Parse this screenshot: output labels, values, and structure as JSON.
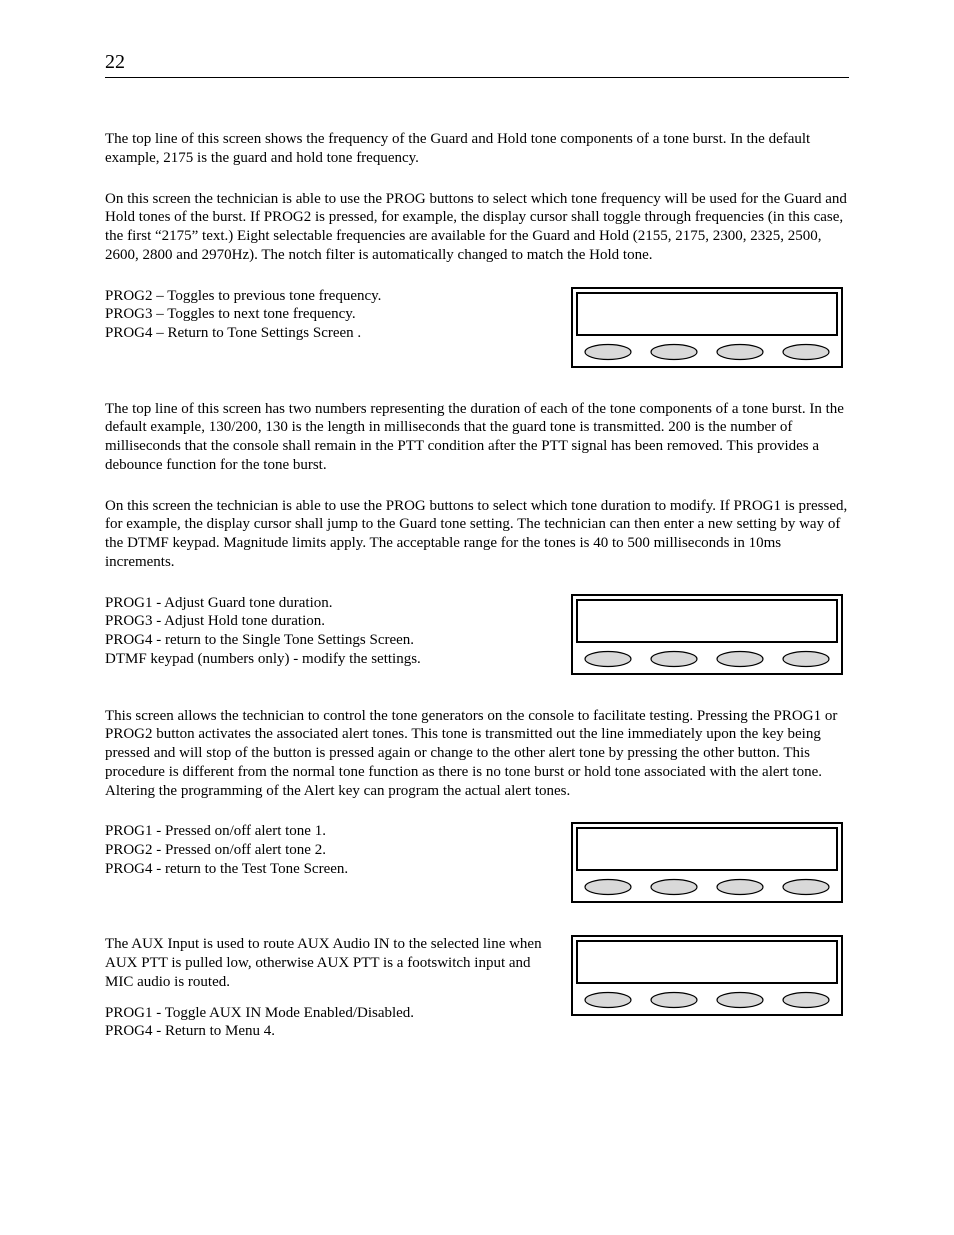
{
  "page_number": "22",
  "section1": {
    "p1": "The top line of this screen shows the frequency of the Guard and Hold tone components of a tone burst.  In the default example, 2175 is the guard and hold tone frequency.",
    "p2": "On this screen the technician is able to use the PROG buttons to select which tone frequency will be used for the Guard and Hold tones of the burst.  If PROG2 is pressed, for example, the display cursor shall toggle through frequencies (in this case, the first “2175” text.)  Eight selectable frequencies are available for the Guard and Hold (2155, 2175, 2300, 2325, 2500, 2600, 2800 and 2970Hz).  The notch filter is automatically changed to match the Hold tone.",
    "prog": {
      "l1": "PROG2 – Toggles to previous tone frequency.",
      "l2": "PROG3 – Toggles to next tone frequency.",
      "l3": "PROG4 – Return to Tone Settings Screen ."
    }
  },
  "section2": {
    "p1": "The top line of this screen has two numbers representing the duration of each of the tone components of a tone burst.  In the default example, 130/200, 130 is the length in milliseconds that the guard tone is transmitted.  200 is the number of milliseconds that the console shall remain in the PTT condition after the PTT signal has been removed.  This provides a debounce function for the tone burst.",
    "p2": "On this screen the technician is able to use the PROG buttons to select which tone duration to modify.  If PROG1 is pressed, for example, the display cursor shall jump to the Guard tone setting.  The technician can then enter a new setting by way of the DTMF keypad.  Magnitude limits apply. The acceptable range for the tones is 40 to 500 milliseconds in 10ms increments.",
    "prog": {
      "l1": "PROG1 - Adjust Guard tone duration.",
      "l2": "PROG3 - Adjust Hold tone duration.",
      "l3": "PROG4 - return to the Single Tone Settings Screen.",
      "l4": "DTMF keypad (numbers only) - modify the settings."
    }
  },
  "section3": {
    "p1": "This screen allows the technician to control the tone generators on the console to facilitate testing.  Pressing the PROG1 or PROG2 button activates the associated alert tones.  This tone is transmitted out the line immediately upon the key being pressed and will stop of the button is pressed again or change to the other alert tone by pressing the other button.  This procedure is different from the normal tone function as there is no tone burst or hold tone associated with the alert tone.  Altering the programming of the Alert key can program the actual alert tones.",
    "prog": {
      "l1": "PROG1 - Pressed on/off alert tone 1.",
      "l2": "PROG2 - Pressed on/off alert tone 2.",
      "l3": "PROG4 - return to the Test Tone Screen."
    }
  },
  "section4": {
    "p1": "The AUX Input is used to route AUX Audio IN to the selected line when AUX PTT is pulled low, otherwise AUX PTT is a footswitch input and MIC audio is routed.",
    "prog": {
      "l1": "PROG1 - Toggle AUX IN Mode Enabled/Disabled.",
      "l2": "PROG4 - Return to Menu 4."
    }
  }
}
